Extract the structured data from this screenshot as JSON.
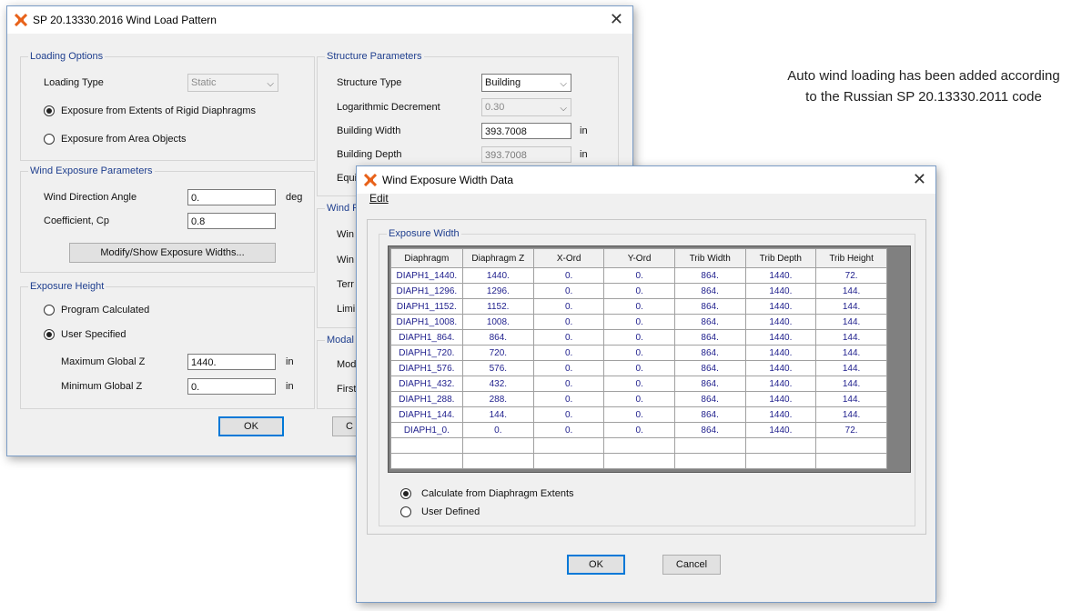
{
  "caption": {
    "line1": "Auto wind loading has been added according",
    "line2": "to the Russian SP 20.13330.2011 code"
  },
  "main_dialog": {
    "title": "SP 20.13330.2016 Wind Load Pattern",
    "icon": "etabs-x-icon",
    "loading_options": {
      "title": "Loading Options",
      "loading_type_label": "Loading Type",
      "loading_type_value": "Static",
      "exposure_rigid_label": "Exposure from Extents of Rigid Diaphragms",
      "exposure_area_label": "Exposure from Area Objects",
      "selected": "rigid"
    },
    "wind_exposure": {
      "title": "Wind Exposure Parameters",
      "direction_label": "Wind Direction Angle",
      "direction_value": "0.",
      "direction_unit": "deg",
      "cp_label": "Coefficient, Cp",
      "cp_value": "0.8",
      "modify_button": "Modify/Show Exposure Widths..."
    },
    "exposure_height": {
      "title": "Exposure Height",
      "program_label": "Program Calculated",
      "user_label": "User Specified",
      "selected": "user",
      "max_label": "Maximum Global Z",
      "max_value": "1440.",
      "max_unit": "in",
      "min_label": "Minimum Global Z",
      "min_value": "0.",
      "min_unit": "in"
    },
    "structure_params": {
      "title": "Structure Parameters",
      "type_label": "Structure Type",
      "type_value": "Building",
      "log_label": "Logarithmic Decrement",
      "log_value": "0.30",
      "width_label": "Building Width",
      "width_value": "393.7008",
      "width_unit": "in",
      "depth_label": "Building Depth",
      "depth_value": "393.7008",
      "depth_unit": "in",
      "equiv_label_partial": "Equi"
    },
    "wind_params_partial": {
      "title": "Wind P",
      "row1": "Win",
      "row2": "Win",
      "row3": "Terr",
      "row4": "Limi"
    },
    "modal_partial": {
      "title": "Modal C",
      "row1": "Mod",
      "row2": "First"
    },
    "ok_button": "OK",
    "cancel_partial": "C"
  },
  "exposure_dialog": {
    "title": "Wind Exposure Width Data",
    "menu_edit": "Edit",
    "group_title": "Exposure Width",
    "columns": [
      "Diaphragm",
      "Diaphragm Z",
      "X-Ord",
      "Y-Ord",
      "Trib Width",
      "Trib Depth",
      "Trib Height"
    ],
    "rows": [
      [
        "DIAPH1_1440.",
        "1440.",
        "0.",
        "0.",
        "864.",
        "1440.",
        "72."
      ],
      [
        "DIAPH1_1296.",
        "1296.",
        "0.",
        "0.",
        "864.",
        "1440.",
        "144."
      ],
      [
        "DIAPH1_1152.",
        "1152.",
        "0.",
        "0.",
        "864.",
        "1440.",
        "144."
      ],
      [
        "DIAPH1_1008.",
        "1008.",
        "0.",
        "0.",
        "864.",
        "1440.",
        "144."
      ],
      [
        "DIAPH1_864.",
        "864.",
        "0.",
        "0.",
        "864.",
        "1440.",
        "144."
      ],
      [
        "DIAPH1_720.",
        "720.",
        "0.",
        "0.",
        "864.",
        "1440.",
        "144."
      ],
      [
        "DIAPH1_576.",
        "576.",
        "0.",
        "0.",
        "864.",
        "1440.",
        "144."
      ],
      [
        "DIAPH1_432.",
        "432.",
        "0.",
        "0.",
        "864.",
        "1440.",
        "144."
      ],
      [
        "DIAPH1_288.",
        "288.",
        "0.",
        "0.",
        "864.",
        "1440.",
        "144."
      ],
      [
        "DIAPH1_144.",
        "144.",
        "0.",
        "0.",
        "864.",
        "1440.",
        "144."
      ],
      [
        "DIAPH1_0.",
        "0.",
        "0.",
        "0.",
        "864.",
        "1440.",
        "72."
      ],
      [
        "",
        "",
        "",
        "",
        "",
        "",
        ""
      ],
      [
        "",
        "",
        "",
        "",
        "",
        "",
        ""
      ]
    ],
    "calc_label": "Calculate from Diaphragm Extents",
    "user_label": "User Defined",
    "selected": "calc",
    "ok_button": "OK",
    "cancel_button": "Cancel"
  },
  "colors": {
    "group_title": "#1e3e8e",
    "cell_text": "#1e1e8c",
    "default_button_border": "#0078d7",
    "dialog_border": "#7a9cc6"
  }
}
